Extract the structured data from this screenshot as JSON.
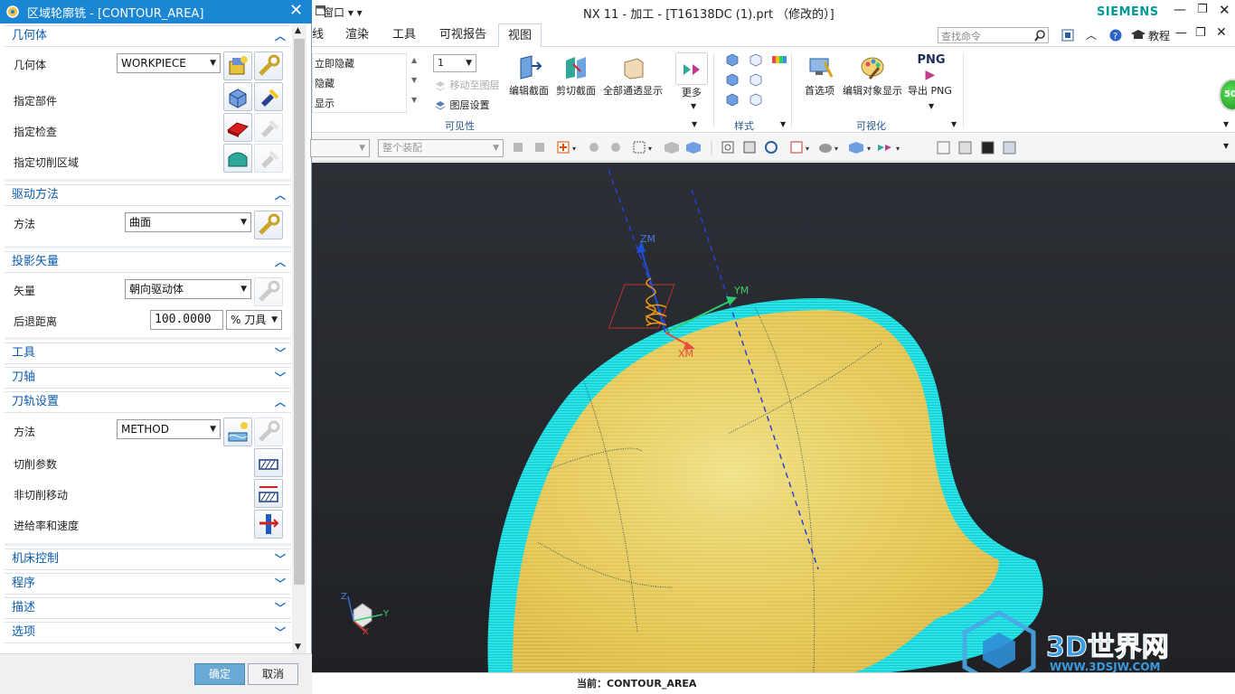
{
  "dialog": {
    "title": "区域轮廓铣 - [CONTOUR_AREA]",
    "sections": {
      "geometry": {
        "header": "几何体",
        "geometry_label": "几何体",
        "geometry_value": "WORKPIECE",
        "specify_part": "指定部件",
        "specify_check": "指定检查",
        "specify_cut_area": "指定切削区域"
      },
      "drive": {
        "header": "驱动方法",
        "method_label": "方法",
        "method_value": "曲面"
      },
      "projection": {
        "header": "投影矢量",
        "vector_label": "矢量",
        "vector_value": "朝向驱动体",
        "retract_label": "后退距离",
        "retract_value": "100.0000",
        "retract_unit": "% 刀具"
      },
      "tool": {
        "header": "工具"
      },
      "axis": {
        "header": "刀轴"
      },
      "path": {
        "header": "刀轨设置",
        "method_label": "方法",
        "method_value": "METHOD",
        "cut_params": "切削参数",
        "non_cut_moves": "非切削移动",
        "feeds_speeds": "进给率和速度"
      },
      "machine": {
        "header": "机床控制"
      },
      "program": {
        "header": "程序"
      },
      "description": {
        "header": "描述"
      },
      "options": {
        "header": "选项"
      }
    },
    "ok_label": "确定",
    "cancel_label": "取消"
  },
  "app": {
    "window_menu": "窗口",
    "window_title": "NX 11 - 加工 - [T16138DC (1).prt （修改的）]",
    "brand": "SIEMENS",
    "tabs": [
      "线",
      "渲染",
      "工具",
      "可视报告",
      "视图"
    ],
    "active_tab": "视图",
    "search_placeholder": "查找命令",
    "tutorial_label": "教程",
    "ribbon": {
      "visibility": {
        "immediate_hide": "立即隐藏",
        "hide": "隐藏",
        "show": "显示",
        "layer_value": "1",
        "move_to_layer": "移动至图层",
        "layer_settings": "图层设置",
        "edit_section": "编辑截面",
        "clip_section": "剪切截面",
        "all_through": "全部通透显示",
        "more": "更多",
        "group_label": "可见性"
      },
      "style_group_label": "样式",
      "visualization": {
        "preferences": "首选项",
        "edit_object_display": "编辑对象显示",
        "export_png": "导出 PNG",
        "png_icon_text": "PNG",
        "group_label": "可视化"
      }
    },
    "toolbar2": {
      "assembly_combo": "整个装配"
    },
    "viewport": {
      "zm": "ZM",
      "ym": "YM",
      "xm": "XM",
      "z": "Z",
      "y": "Y",
      "x": "X"
    },
    "watermark": {
      "title": "3D世界网",
      "url": "WWW.3DSJW.COM"
    },
    "status": {
      "current": "当前：CONTOUR_AREA"
    },
    "badge": "50"
  }
}
